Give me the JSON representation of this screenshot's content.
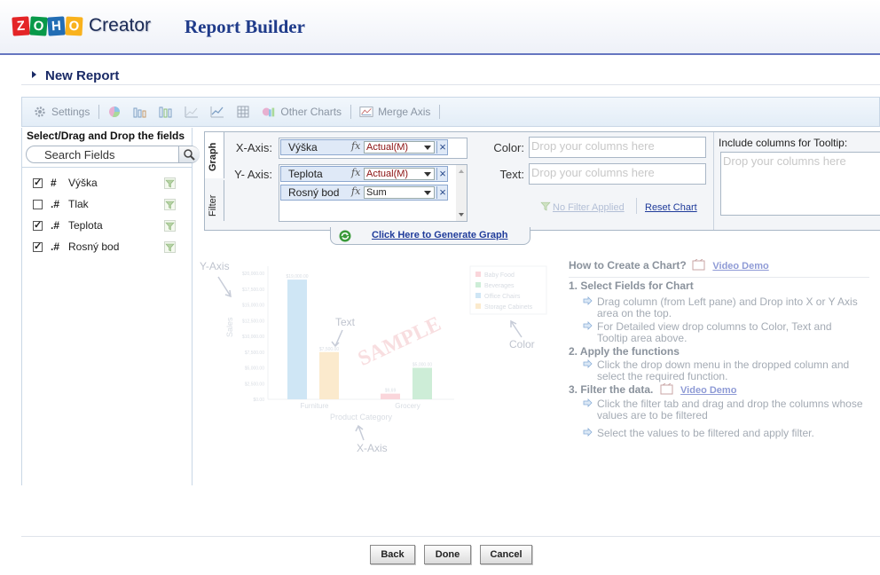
{
  "header": {
    "logo_letters": [
      "Z",
      "O",
      "H",
      "O"
    ],
    "logo_word": "Creator",
    "title": "Report Builder"
  },
  "report": {
    "title": "New Report"
  },
  "toolbar": {
    "settings_label": "Settings",
    "other_charts_label": "Other Charts",
    "merge_axis_label": "Merge Axis"
  },
  "left_panel": {
    "title": "Select/Drag and Drop the fields",
    "search_placeholder": "Search Fields",
    "fields": [
      {
        "name": "Výška",
        "type": "#",
        "checked": true
      },
      {
        "name": "Tlak",
        "type": ".#",
        "checked": false
      },
      {
        "name": "Teplota",
        "type": ".#",
        "checked": true
      },
      {
        "name": "Rosný bod",
        "type": ".#",
        "checked": true
      }
    ]
  },
  "config": {
    "tabs": [
      "Graph",
      "Filter"
    ],
    "x_axis_label": "X-Axis:",
    "y_axis_label": "Y- Axis:",
    "x_axis_pills": [
      {
        "name": "Výška",
        "function": "Actual(M)"
      }
    ],
    "y_axis_pills": [
      {
        "name": "Teplota",
        "function": "Actual(M)"
      },
      {
        "name": "Rosný bod",
        "function": "Sum"
      }
    ],
    "color_label": "Color:",
    "color_placeholder": "Drop your columns here",
    "text_label": "Text:",
    "text_placeholder": "Drop your columns here",
    "tooltip_label": "Include columns for Tooltip:",
    "tooltip_placeholder": "Drop your columns here",
    "no_filter_label": "No Filter Applied",
    "reset_chart_label": "Reset Chart",
    "generate_label": "Click Here to Generate Graph"
  },
  "sample_chart": {
    "y_axis_caption": "Y-Axis",
    "x_axis_caption": "X-Axis",
    "text_caption": "Text",
    "color_caption": "Color",
    "watermark": "SAMPLE",
    "ylabel": "Sales",
    "xlabel": "Product Category",
    "categories": [
      "Furniture",
      "Grocery"
    ],
    "ticks": [
      "$20,000.00",
      "$17,500.00",
      "$15,000.00",
      "$12,500.00",
      "$10,000.00",
      "$7,500.00",
      "$5,000.00",
      "$2,500.00",
      "$0.00"
    ],
    "legend": [
      "Baby Food",
      "Beverages",
      "Office Chairs",
      "Storage Cabinets"
    ],
    "legend_colors": [
      "#f6b6bf",
      "#a6dfb7",
      "#a9d3ee",
      "#f8d9a5"
    ],
    "bar_labels": [
      "$19,000.00",
      "$7,500.00",
      "$9,69",
      "$5,000.00"
    ],
    "bars": [
      {
        "group": 0,
        "legend_index": 2,
        "value": 19000
      },
      {
        "group": 0,
        "legend_index": 3,
        "value": 7500
      },
      {
        "group": 1,
        "legend_index": 0,
        "value": 900
      },
      {
        "group": 1,
        "legend_index": 1,
        "value": 5000
      }
    ],
    "ylim": [
      0,
      20000
    ]
  },
  "help": {
    "title": "How to Create a Chart?",
    "video_demo": "Video Demo",
    "sections": [
      {
        "title": "1. Select Fields for Chart",
        "items": [
          "Drag column (from Left pane) and Drop into X or Y Axis area on the top.",
          "For Detailed view drop columns to Color, Text and Tooltip area above."
        ]
      },
      {
        "title": "2. Apply the functions",
        "items": [
          "Click the drop down menu in the dropped column and select the required function."
        ]
      },
      {
        "title": "3. Filter the data.",
        "items": [
          "Click the filter tab and drag and drop the columns whose values are to be filtered",
          "Select the values to be filtered and apply filter."
        ]
      }
    ]
  },
  "footer": {
    "back_label": "Back",
    "done_label": "Done",
    "cancel_label": "Cancel"
  }
}
